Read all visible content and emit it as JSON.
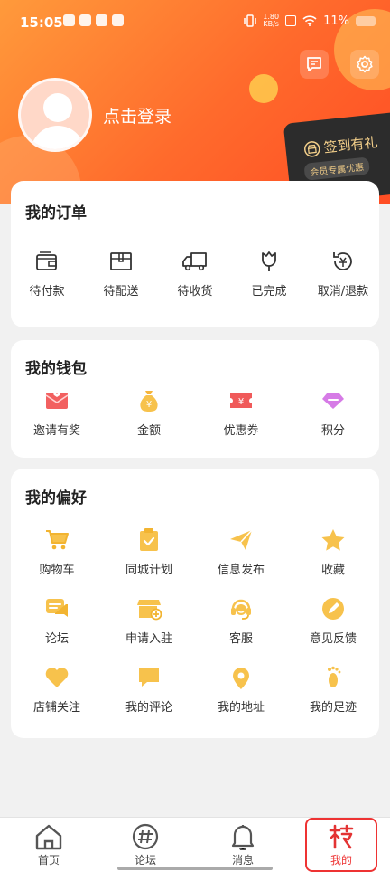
{
  "status": {
    "time": "15:05",
    "speed_top": "1.80",
    "speed_bottom": "KB/s",
    "battery": "11%"
  },
  "header": {
    "login_text": "点击登录",
    "signin_title": "签到有礼",
    "signin_badge": "会员专属优惠",
    "accent": "#ff6a2c"
  },
  "orders": {
    "title": "我的订单",
    "items": [
      {
        "label": "待付款",
        "icon": "wallet-icon"
      },
      {
        "label": "待配送",
        "icon": "package-icon"
      },
      {
        "label": "待收货",
        "icon": "truck-icon"
      },
      {
        "label": "已完成",
        "icon": "tulip-icon"
      },
      {
        "label": "取消/退款",
        "icon": "refund-icon"
      }
    ]
  },
  "wallet": {
    "title": "我的钱包",
    "items": [
      {
        "label": "邀请有奖",
        "icon": "gift-envelope-icon"
      },
      {
        "label": "金额",
        "icon": "money-bag-icon"
      },
      {
        "label": "优惠券",
        "icon": "coupon-icon"
      },
      {
        "label": "积分",
        "icon": "gem-icon"
      }
    ]
  },
  "preferences": {
    "title": "我的偏好",
    "items": [
      {
        "label": "购物车",
        "icon": "cart-icon"
      },
      {
        "label": "同城计划",
        "icon": "clipboard-icon"
      },
      {
        "label": "信息发布",
        "icon": "send-icon"
      },
      {
        "label": "收藏",
        "icon": "star-icon"
      },
      {
        "label": "论坛",
        "icon": "chat-icon"
      },
      {
        "label": "申请入驻",
        "icon": "store-icon"
      },
      {
        "label": "客服",
        "icon": "headset-icon"
      },
      {
        "label": "意见反馈",
        "icon": "pencil-icon"
      },
      {
        "label": "店铺关注",
        "icon": "heart-icon"
      },
      {
        "label": "我的评论",
        "icon": "comment-icon"
      },
      {
        "label": "我的地址",
        "icon": "location-icon"
      },
      {
        "label": "我的足迹",
        "icon": "footprint-icon"
      }
    ]
  },
  "tabbar": {
    "items": [
      {
        "label": "首页",
        "icon": "home-icon"
      },
      {
        "label": "论坛",
        "icon": "hash-icon"
      },
      {
        "label": "消息",
        "icon": "bell-icon"
      },
      {
        "label": "我的",
        "icon": "branch-logo-icon"
      }
    ],
    "active": "我的",
    "active_color": "#e33333"
  }
}
